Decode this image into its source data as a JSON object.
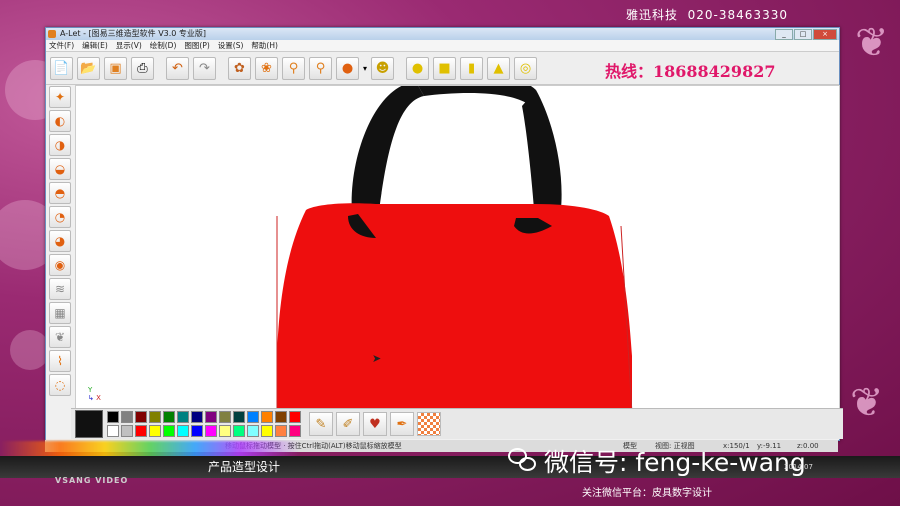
{
  "brand": {
    "company": "雅迅科技",
    "phone": "020-38463330"
  },
  "window": {
    "title": "A-Let - [图易三维造型软件 V3.0 专业版]",
    "controls": [
      "_",
      "□",
      "×"
    ]
  },
  "menu": [
    "文件(F)",
    "编辑(E)",
    "显示(V)",
    "绘制(D)",
    "图图(P)",
    "设置(S)",
    "帮助(H)"
  ],
  "toolbar": {
    "buttons": [
      "new-doc",
      "open-doc",
      "box",
      "print",
      "undo",
      "redo",
      "palette",
      "paw",
      "zoom",
      "zoom-fit",
      "sphere",
      "arrow-down",
      "face",
      "circle",
      "cube",
      "cylinder",
      "cone",
      "ring"
    ],
    "hotline": "热线：18688429827"
  },
  "left_tools": [
    "pick",
    "shape-a",
    "shape-b",
    "shape-c",
    "shape-d",
    "shape-e",
    "shape-f",
    "shape-g",
    "wave",
    "grid",
    "butterfly",
    "curve",
    "lasso"
  ],
  "palette": {
    "current": "#111111",
    "colors_row1": [
      "#000000",
      "#808080",
      "#800000",
      "#808000",
      "#008000",
      "#008080",
      "#000080",
      "#800080",
      "#808040",
      "#004040",
      "#0080ff",
      "#ff8000",
      "#804000",
      "#ff0000"
    ],
    "colors_row2": [
      "#ffffff",
      "#c0c0c0",
      "#ff0000",
      "#ffff00",
      "#00ff00",
      "#00ffff",
      "#0000ff",
      "#ff00ff",
      "#ffff80",
      "#00ff80",
      "#80ffff",
      "#ffff00",
      "#ff8040",
      "#ff0080"
    ]
  },
  "status": {
    "left": "移动鼠标拖动模型 · 按住Ctrl拖动(ALT)移动鼠标缩放模型",
    "mode": "模型",
    "view": "视图: 正视图",
    "x": "x:150/1",
    "y": "y:-9.11",
    "z": "z:0.00"
  },
  "video": {
    "brand": "VSANG VIDEO",
    "subtitle": "产品造型设计",
    "wechat": "微信号: feng-ke-wang",
    "date": "2014.07",
    "follow": "关注微信平台：皮具数字设计"
  },
  "colors": {
    "bag": "#ee0e0e",
    "handle": "#111111",
    "hotline": "#e0186a"
  }
}
